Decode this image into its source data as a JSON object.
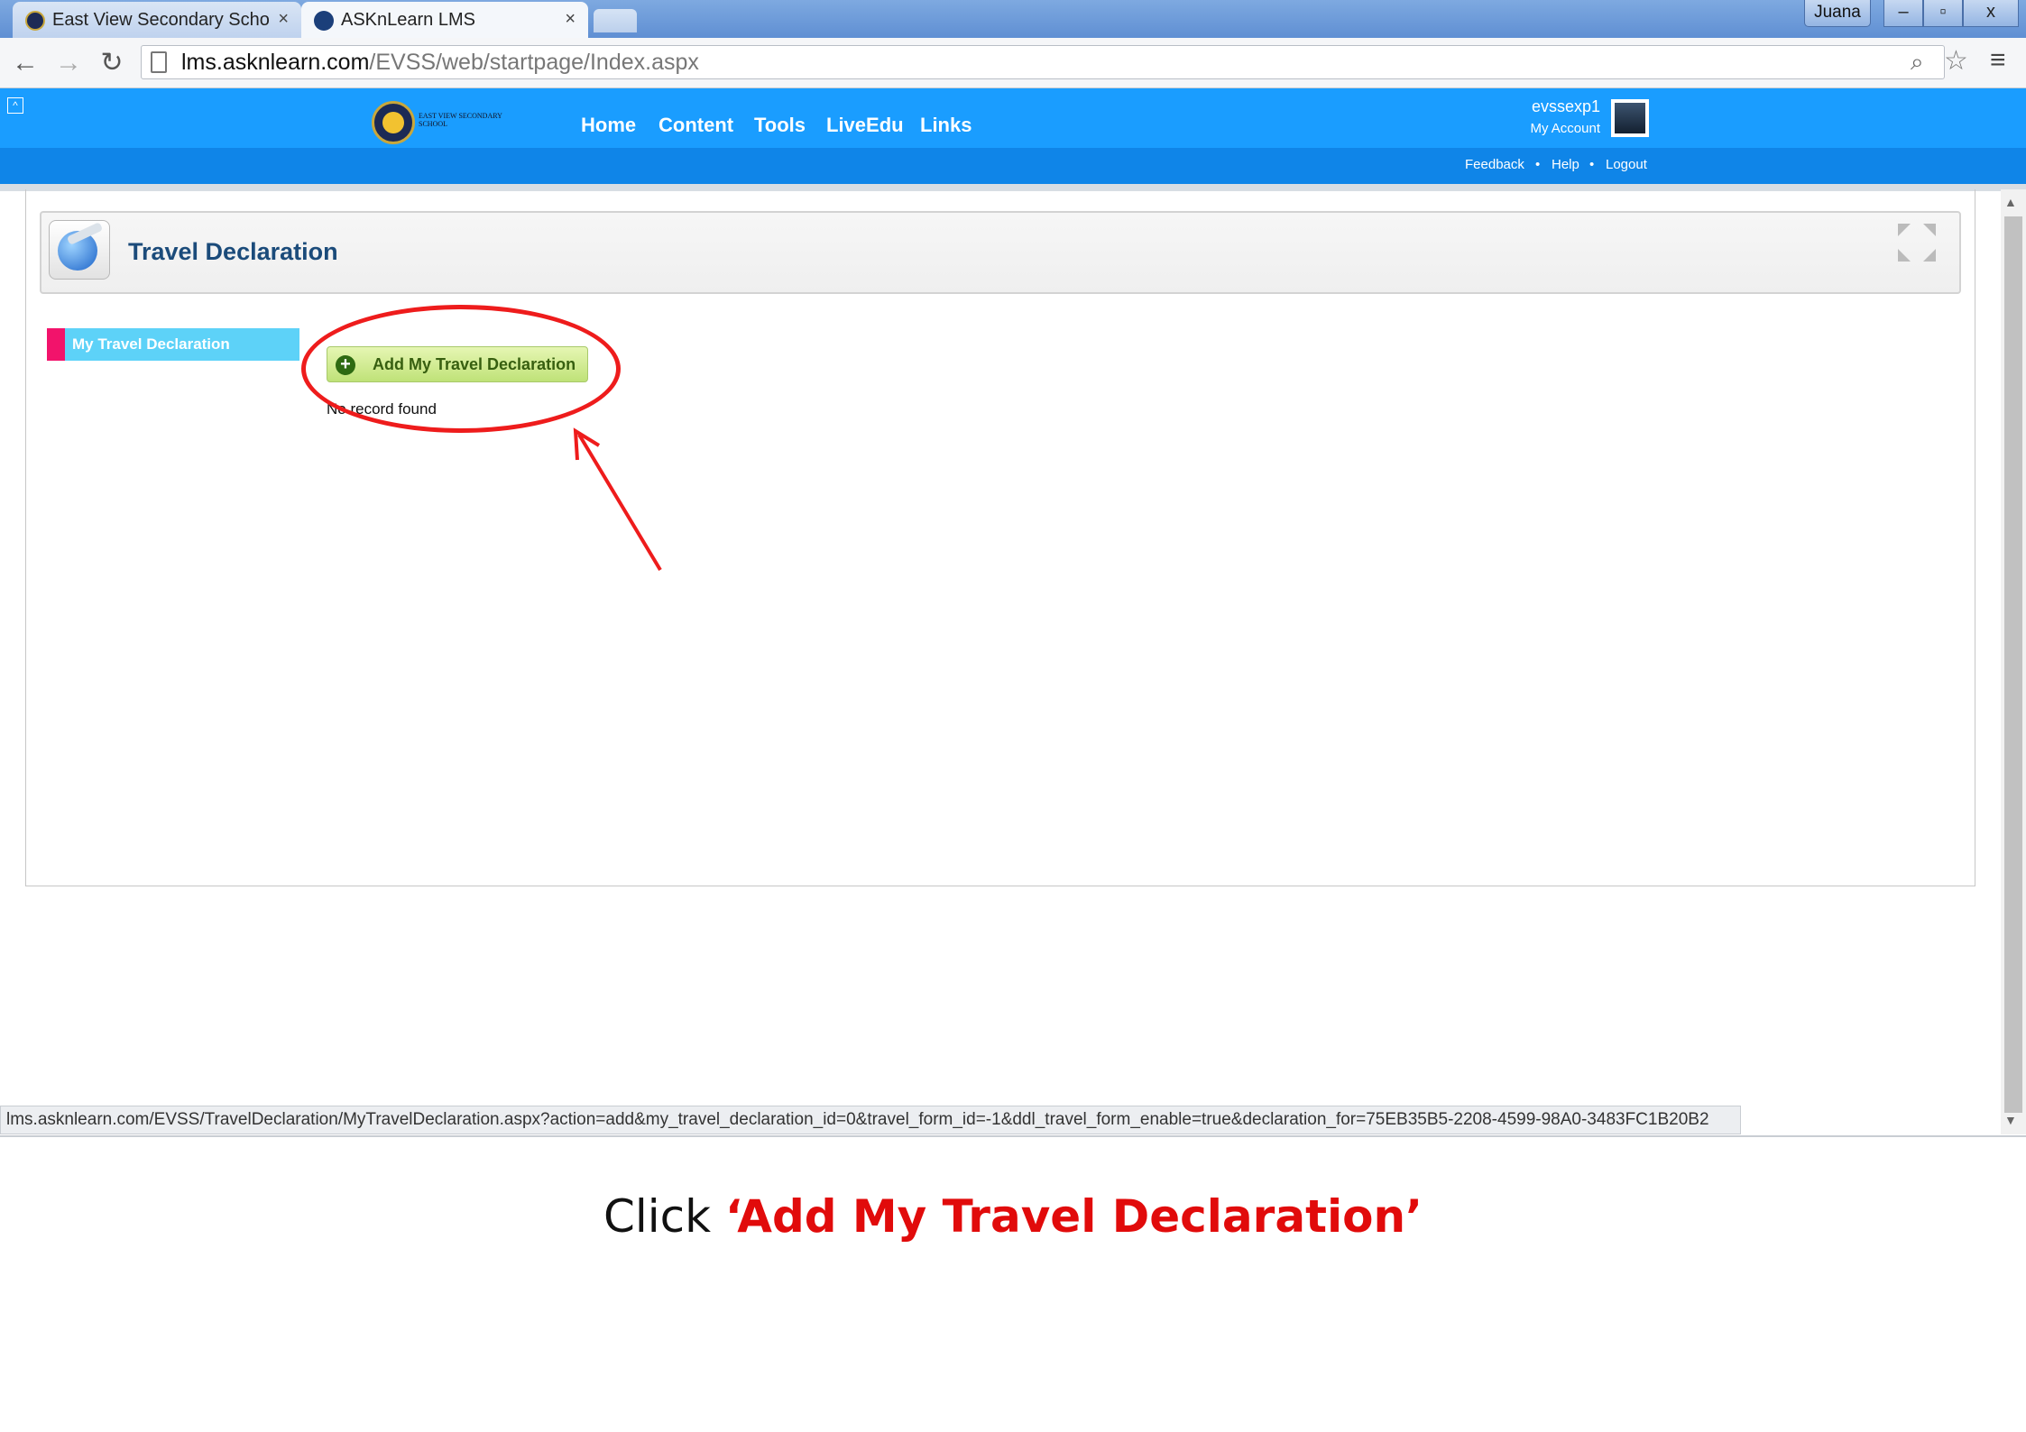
{
  "browser": {
    "tabs": [
      {
        "label": "East View Secondary Scho",
        "close": "×"
      },
      {
        "label": "ASKnLearn LMS",
        "close": "×"
      }
    ],
    "user_label": "Juana",
    "window_buttons": [
      "–",
      "▫",
      "x"
    ],
    "url_host": "lms.asknlearn.com",
    "url_path": "/EVSS/web/startpage/Index.aspx",
    "status_url": "lms.asknlearn.com/EVSS/TravelDeclaration/MyTravelDeclaration.aspx?action=add&my_travel_declaration_id=0&travel_form_id=-1&ddl_travel_form_enable=true&declaration_for=75EB35B5-2208-4599-98A0-3483FC1B20B2"
  },
  "app_header": {
    "logo_text": "EAST VIEW SECONDARY SCHOOL",
    "nav": [
      "Home",
      "Content",
      "Tools",
      "LiveEdu",
      "Links"
    ],
    "username": "evssexp1",
    "my_account": "My Account",
    "sublinks": [
      "Feedback",
      "Help",
      "Logout"
    ],
    "separator": "•"
  },
  "page": {
    "title": "Travel Declaration",
    "sidebar_item": "My Travel Declaration",
    "add_button": "Add My Travel Declaration",
    "empty_message": "No record found"
  },
  "caption": {
    "prefix": "Click ",
    "highlight": "‘Add My Travel Declaration’"
  },
  "colors": {
    "header_blue": "#1a9dff",
    "annotation_red": "#ee1c1c",
    "sidebar_accent": "#f2136b",
    "sidebar_bg": "#5dd2f8"
  }
}
